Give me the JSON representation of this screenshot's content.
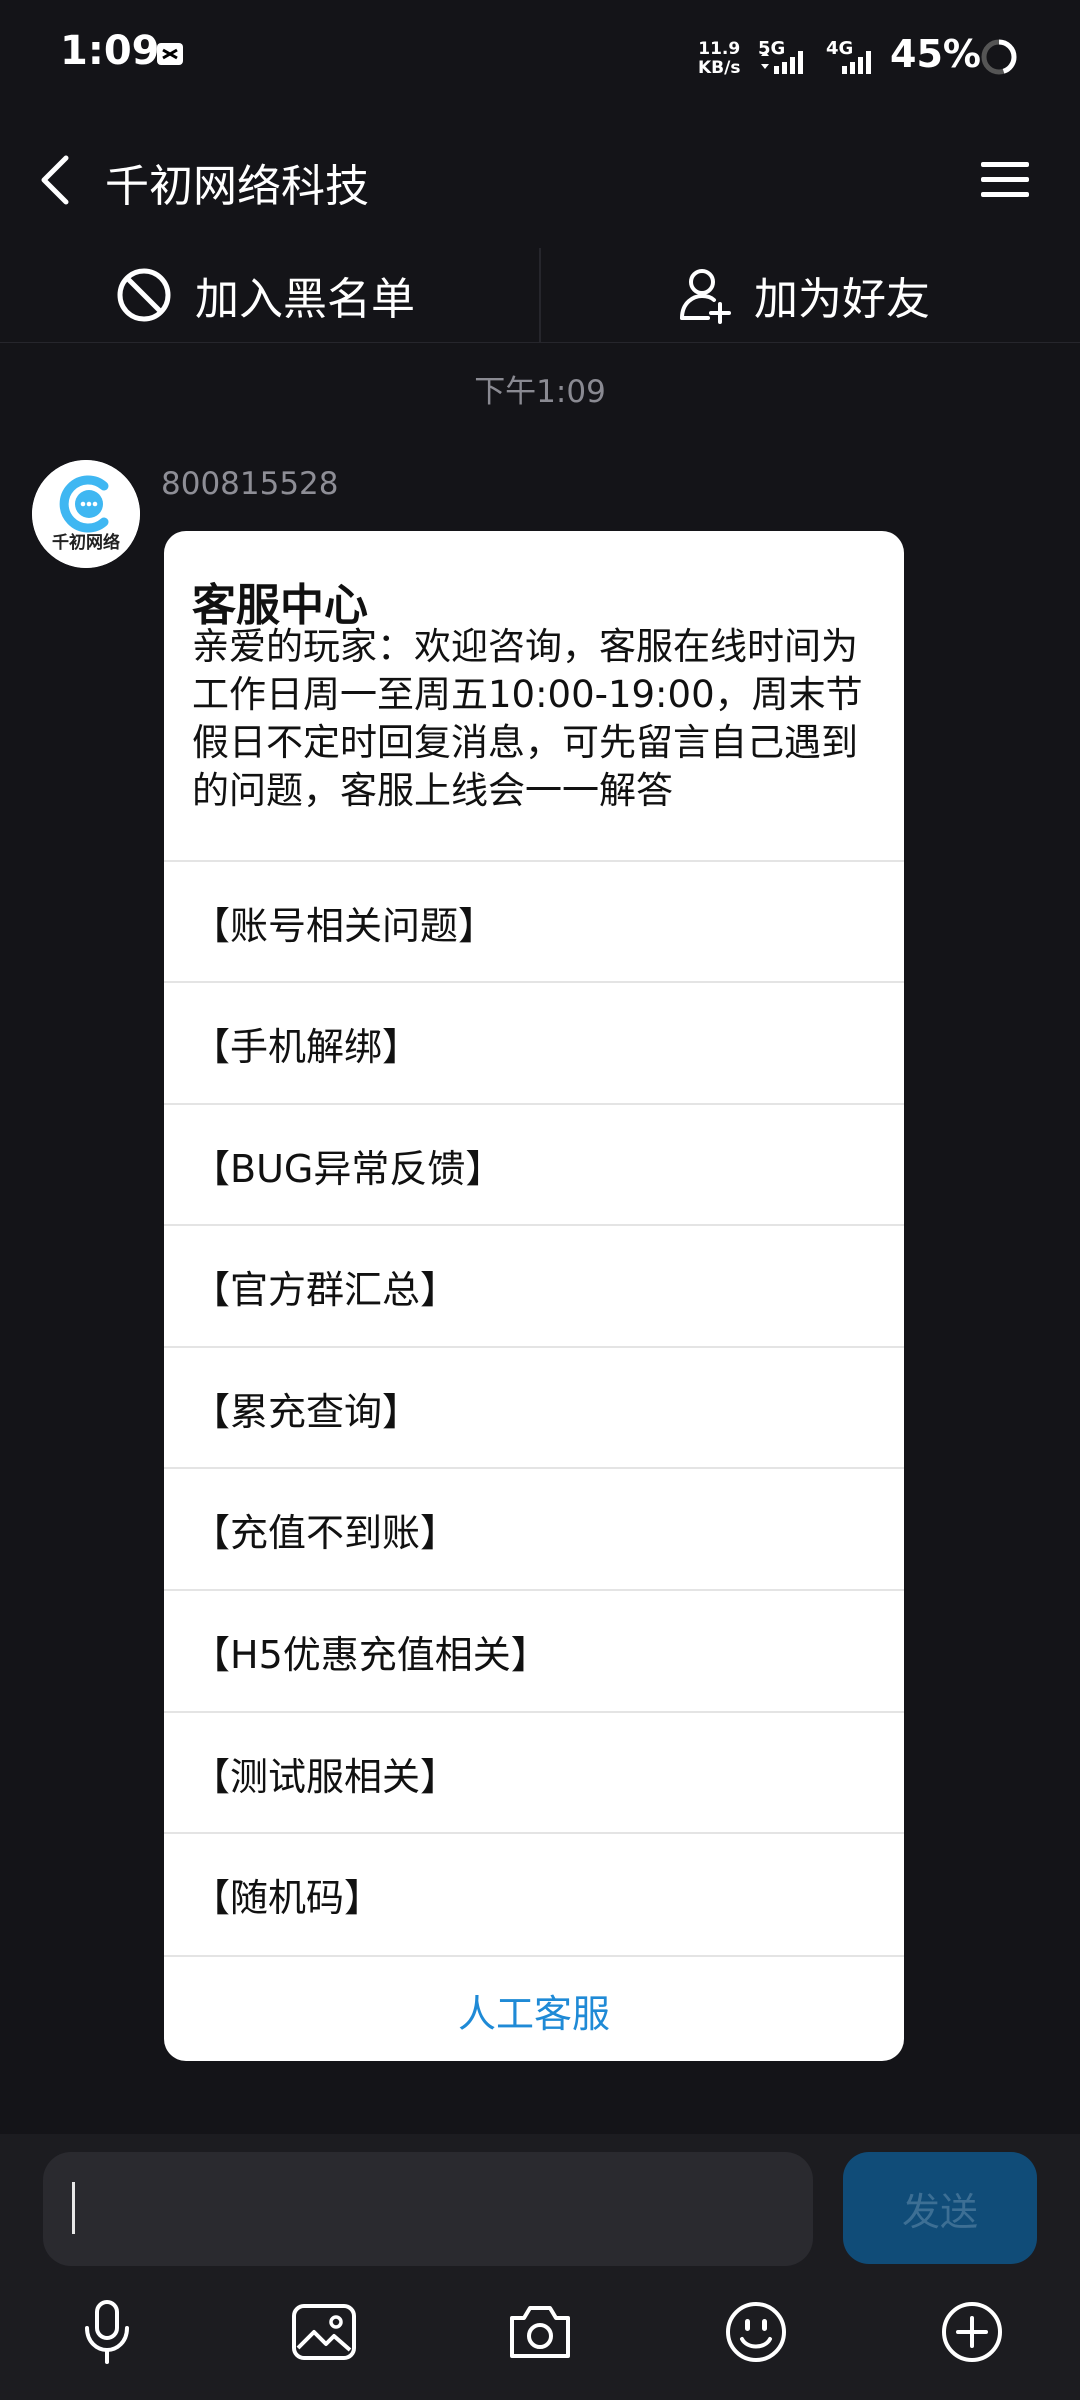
{
  "status_bar": {
    "time": "1:09",
    "net_speed_value": "11.9",
    "net_speed_unit": "KB/s",
    "sim1_label": "5G",
    "sim2_label": "4G",
    "battery": "45%",
    "battery_level": 0.45
  },
  "header": {
    "title": "千初网络科技",
    "back_icon": "chevron-left-icon",
    "menu_icon": "hamburger-menu-icon"
  },
  "actions": {
    "block_label": "加入黑名单",
    "block_icon": "ban-icon",
    "add_friend_label": "加为好友",
    "add_friend_icon": "person-add-icon"
  },
  "conversation": {
    "timestamp": "下午1:09",
    "sender_id": "800815528",
    "avatar_text": "千初网络"
  },
  "card": {
    "title": "客服中心",
    "body": "亲爱的玩家：欢迎咨询，客服在线时间为工作日周一至周五10:00-19:00，周末节假日不定时回复消息，可先留言自己遇到的问题，客服上线会一一解答",
    "items": [
      "【账号相关问题】",
      "【手机解绑】",
      "【BUG异常反馈】",
      "【官方群汇总】",
      "【累充查询】",
      "【充值不到账】",
      "【H5优惠充值相关】",
      "【测试服相关】",
      "【随机码】"
    ],
    "footer": "人工客服"
  },
  "composer": {
    "input_value": "",
    "send_label": "发送"
  },
  "toolbar": {
    "icons": [
      "microphone-icon",
      "image-icon",
      "camera-icon",
      "emoji-icon",
      "plus-icon"
    ]
  },
  "colors": {
    "background": "#141418",
    "link_blue": "#1f8ad6",
    "send_button": "#104c78",
    "avatar_accent": "#3fb7f2"
  }
}
